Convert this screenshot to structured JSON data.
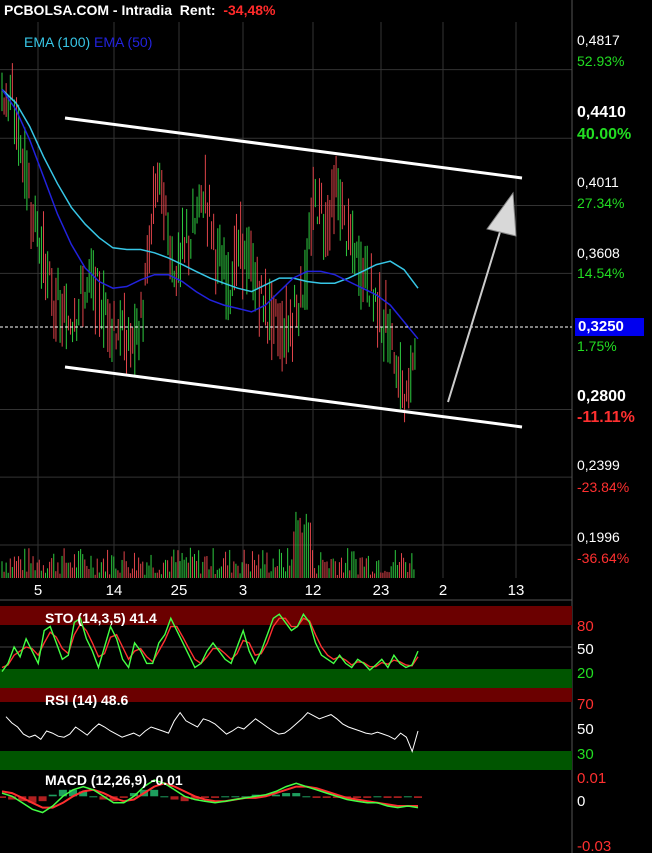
{
  "header": {
    "title": "PCBOLSA.COM - Intradia",
    "rent_label": "Rent:",
    "rent_value": "-34,48%"
  },
  "colors": {
    "background": "#000000",
    "up_candle": "#2ecc40",
    "down_candle": "#e0444a",
    "ema100": "#37c6e6",
    "ema50": "#2222dd",
    "price_box": "#0000ee",
    "overbought_band": "#6b0000",
    "oversold_band": "#005500",
    "trendline": "#ffffff",
    "arrow": "#cccccc"
  },
  "chart_data": [
    {
      "type": "candlestick",
      "title": "PCBOLSA.COM - Intradia",
      "legend": [
        "EMA (100)",
        "EMA (50)"
      ],
      "legend_position": "top-left",
      "ylim": [
        0.18,
        0.51
      ],
      "x_ticks": [
        "5",
        "14",
        "25",
        "3",
        "12",
        "23",
        "2",
        "13"
      ],
      "price_levels": [
        {
          "price": "0,4817",
          "pct": "52.93%",
          "sign": "pos",
          "bold": false
        },
        {
          "price": "0,4410",
          "pct": "40.00%",
          "sign": "pos",
          "bold": true
        },
        {
          "price": "0,4011",
          "pct": "27.34%",
          "sign": "pos",
          "bold": false
        },
        {
          "price": "0,3608",
          "pct": "14.54%",
          "sign": "pos",
          "bold": false
        },
        {
          "price": "0,3250",
          "pct": "1.75%",
          "sign": "pos",
          "bold": false,
          "current": true
        },
        {
          "price": "0,2800",
          "pct": "-11.11%",
          "sign": "neg",
          "bold": true
        },
        {
          "price": "0,2399",
          "pct": "-23.84%",
          "sign": "neg",
          "bold": false
        },
        {
          "price": "0,1996",
          "pct": "-36.64%",
          "sign": "neg",
          "bold": false
        }
      ],
      "close_trend": [
        0.47,
        0.465,
        0.455,
        0.44,
        0.42,
        0.4,
        0.385,
        0.37,
        0.35,
        0.34,
        0.335,
        0.33,
        0.34,
        0.345,
        0.35,
        0.355,
        0.345,
        0.34,
        0.335,
        0.33,
        0.325,
        0.32,
        0.318,
        0.33,
        0.35,
        0.39,
        0.42,
        0.4,
        0.38,
        0.36,
        0.37,
        0.38,
        0.385,
        0.4,
        0.41,
        0.39,
        0.37,
        0.36,
        0.355,
        0.37,
        0.375,
        0.368,
        0.36,
        0.35,
        0.34,
        0.335,
        0.33,
        0.325,
        0.33,
        0.34,
        0.35,
        0.36,
        0.4,
        0.405,
        0.39,
        0.4,
        0.41,
        0.395,
        0.38,
        0.37,
        0.365,
        0.36,
        0.35,
        0.34,
        0.33,
        0.32,
        0.305,
        0.29,
        0.285,
        0.33
      ],
      "ema100": [
        0.47,
        0.462,
        0.448,
        0.43,
        0.414,
        0.4,
        0.39,
        0.382,
        0.376,
        0.375,
        0.375,
        0.373,
        0.37,
        0.366,
        0.362,
        0.358,
        0.355,
        0.352,
        0.35,
        0.354,
        0.358,
        0.358,
        0.356,
        0.355,
        0.355,
        0.358,
        0.362,
        0.366,
        0.368,
        0.363,
        0.352
      ],
      "ema50": [
        0.47,
        0.458,
        0.44,
        0.418,
        0.396,
        0.378,
        0.364,
        0.356,
        0.352,
        0.353,
        0.357,
        0.36,
        0.36,
        0.356,
        0.35,
        0.345,
        0.342,
        0.34,
        0.338,
        0.342,
        0.35,
        0.358,
        0.362,
        0.362,
        0.36,
        0.356,
        0.352,
        0.348,
        0.342,
        0.332,
        0.322
      ]
    },
    {
      "type": "line",
      "title": "STO (14,3,5) 41.4",
      "levels": [
        "80",
        "50",
        "20"
      ],
      "ylim": [
        0,
        100
      ],
      "k": [
        20,
        30,
        50,
        38,
        60,
        45,
        30,
        70,
        75,
        55,
        35,
        40,
        80,
        85,
        60,
        45,
        25,
        50,
        75,
        60,
        35,
        25,
        55,
        45,
        30,
        30,
        55,
        65,
        85,
        70,
        55,
        40,
        25,
        30,
        45,
        55,
        45,
        35,
        30,
        50,
        70,
        45,
        30,
        45,
        65,
        85,
        90,
        80,
        70,
        75,
        90,
        80,
        55,
        40,
        35,
        30,
        40,
        30,
        25,
        35,
        30,
        22,
        28,
        35,
        25,
        40,
        30,
        25,
        28,
        45
      ],
      "d": [
        25,
        28,
        40,
        45,
        50,
        48,
        40,
        55,
        68,
        62,
        48,
        42,
        65,
        78,
        70,
        55,
        38,
        42,
        62,
        65,
        50,
        35,
        45,
        48,
        38,
        32,
        45,
        58,
        75,
        75,
        62,
        48,
        35,
        30,
        38,
        48,
        48,
        42,
        35,
        42,
        58,
        55,
        40,
        42,
        55,
        75,
        85,
        85,
        75,
        75,
        85,
        82,
        65,
        50,
        40,
        35,
        38,
        34,
        28,
        32,
        31,
        26,
        26,
        31,
        29,
        34,
        32,
        28,
        27,
        38
      ]
    },
    {
      "type": "line",
      "title": "RSI (14) 48.6",
      "levels": [
        "70",
        "50",
        "30"
      ],
      "ylim": [
        0,
        100
      ],
      "values": [
        62,
        56,
        52,
        45,
        42,
        44,
        40,
        48,
        46,
        43,
        42,
        45,
        52,
        48,
        44,
        50,
        55,
        52,
        48,
        45,
        42,
        44,
        46,
        43,
        48,
        52,
        50,
        48,
        46,
        58,
        66,
        58,
        55,
        52,
        60,
        58,
        55,
        50,
        45,
        48,
        52,
        50,
        55,
        60,
        56,
        52,
        48,
        45,
        46,
        50,
        55,
        60,
        66,
        63,
        60,
        62,
        64,
        60,
        55,
        52,
        50,
        48,
        46,
        45,
        47,
        45,
        43,
        40,
        46,
        42,
        28,
        48
      ]
    },
    {
      "type": "line",
      "title": "MACD (12,26,9) -0.01",
      "levels": [
        "0.01",
        "0",
        "-0.03"
      ],
      "ylim": [
        -0.035,
        0.015
      ],
      "macd": [
        0.002,
        0.0,
        -0.004,
        -0.008,
        -0.01,
        -0.006,
        0.0,
        0.004,
        0.006,
        0.004,
        0.0,
        -0.004,
        -0.004,
        0.0,
        0.006,
        0.01,
        0.008,
        0.004,
        0.0,
        -0.002,
        -0.003,
        -0.004,
        -0.003,
        -0.002,
        -0.001,
        0.0,
        0.001,
        0.003,
        0.006,
        0.008,
        0.006,
        0.004,
        0.002,
        0.0,
        -0.002,
        -0.003,
        -0.004,
        -0.004,
        -0.006,
        -0.007,
        -0.006,
        -0.007
      ],
      "signal": [
        0.003,
        0.002,
        -0.001,
        -0.004,
        -0.007,
        -0.007,
        -0.004,
        0.0,
        0.003,
        0.004,
        0.002,
        -0.001,
        -0.003,
        -0.002,
        0.002,
        0.006,
        0.008,
        0.006,
        0.003,
        0.0,
        -0.002,
        -0.003,
        -0.003,
        -0.002,
        -0.001,
        -0.001,
        0.0,
        0.002,
        0.004,
        0.006,
        0.006,
        0.005,
        0.003,
        0.001,
        -0.001,
        -0.002,
        -0.003,
        -0.004,
        -0.005,
        -0.006,
        -0.006,
        -0.006
      ],
      "histogram": [
        -0.001,
        -0.002,
        -0.003,
        -0.004,
        -0.003,
        0.001,
        0.004,
        0.004,
        0.003,
        0.0,
        -0.002,
        -0.003,
        -0.001,
        0.002,
        0.004,
        0.004,
        0.0,
        -0.002,
        -0.003,
        -0.002,
        -0.001,
        -0.001,
        0.0,
        0.0,
        0.0,
        0.001,
        0.001,
        0.001,
        0.002,
        0.002,
        0.0,
        -0.001,
        -0.001,
        -0.001,
        -0.001,
        -0.001,
        -0.001,
        0.0,
        -0.001,
        -0.001,
        0.0,
        -0.001
      ]
    }
  ],
  "indicators": {
    "ema100_label": "EMA (100)",
    "ema50_label": "EMA (50)",
    "sto_label": "STO (14,3,5) 41.4",
    "sto_levels": [
      "80",
      "50",
      "20"
    ],
    "rsi_label": "RSI (14) 48.6",
    "rsi_levels": [
      "70",
      "50",
      "30"
    ],
    "macd_label": "MACD (12,26,9) -0.01",
    "macd_levels": [
      "0.01",
      "0",
      "-0.03"
    ]
  }
}
